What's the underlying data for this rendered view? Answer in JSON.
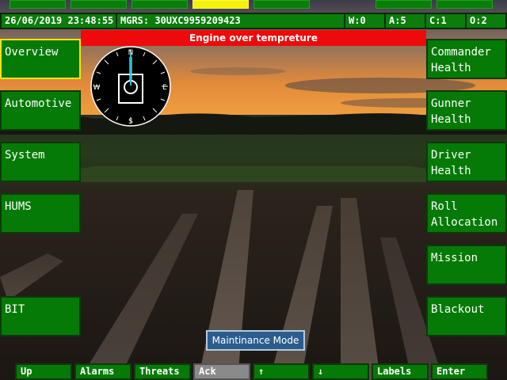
{
  "status": {
    "datetime": "26/06/2019 23:48:55",
    "mgrs": "MGRS: 30UXC9959209423",
    "w": "W:0",
    "a": "A:5",
    "c": "C:1",
    "o": "O:2"
  },
  "alert": "Engine over tempreture",
  "left_menu": [
    "Overview",
    "Automotive",
    "System",
    "HUMS",
    "BIT"
  ],
  "right_menu": [
    "Commander\nHealth",
    "Gunner\nHealth",
    "Driver\nHealth",
    "Roll\nAllocation",
    "Mission",
    "Blackout"
  ],
  "bottom_menu": [
    "Up",
    "Alarms",
    "Threats",
    "Ack",
    "↑",
    "↓",
    "Labels",
    "Enter"
  ],
  "mode_button": "Maintinance Mode",
  "compass": {
    "n": "N",
    "e": "E",
    "s": "S",
    "w": "W"
  },
  "colors": {
    "panel_green": "#067a06",
    "alert_red": "#ee0a0a",
    "active_yellow": "#f2f20a",
    "selected_border": "#f4e40c",
    "mode_blue": "#2a5d8e"
  }
}
